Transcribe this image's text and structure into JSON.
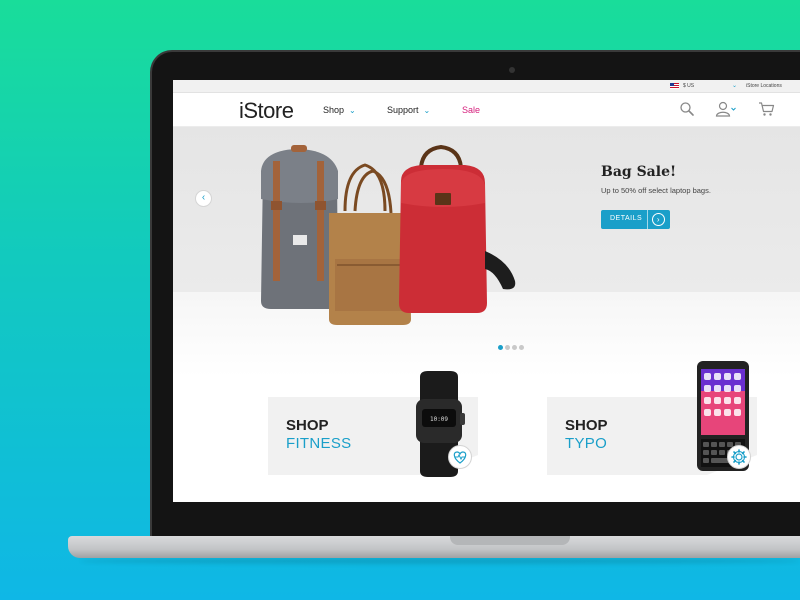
{
  "utility": {
    "currency": "$ US",
    "locations": "iStore Locations"
  },
  "nav": {
    "logo": "iStore",
    "items": [
      {
        "label": "Shop"
      },
      {
        "label": "Support"
      },
      {
        "label": "Sale"
      }
    ],
    "icons": [
      "search-icon",
      "user-icon",
      "cart-icon"
    ]
  },
  "hero": {
    "title": "Bag Sale!",
    "subtitle": "Up to 50% off select laptop bags.",
    "button_label": "DETAILS",
    "slide_count": 4,
    "active_slide": 1
  },
  "tiles": [
    {
      "line1": "SHOP",
      "line2": "FITNESS",
      "icon": "heart-monitor-icon"
    },
    {
      "line1": "SHOP",
      "line2": "TYPO",
      "icon": "gear-icon"
    }
  ],
  "colors": {
    "accent": "#1a9fc9",
    "sale": "#d6207d",
    "bg_top": "#19dd9a",
    "bg_bottom": "#0fb7e6"
  }
}
